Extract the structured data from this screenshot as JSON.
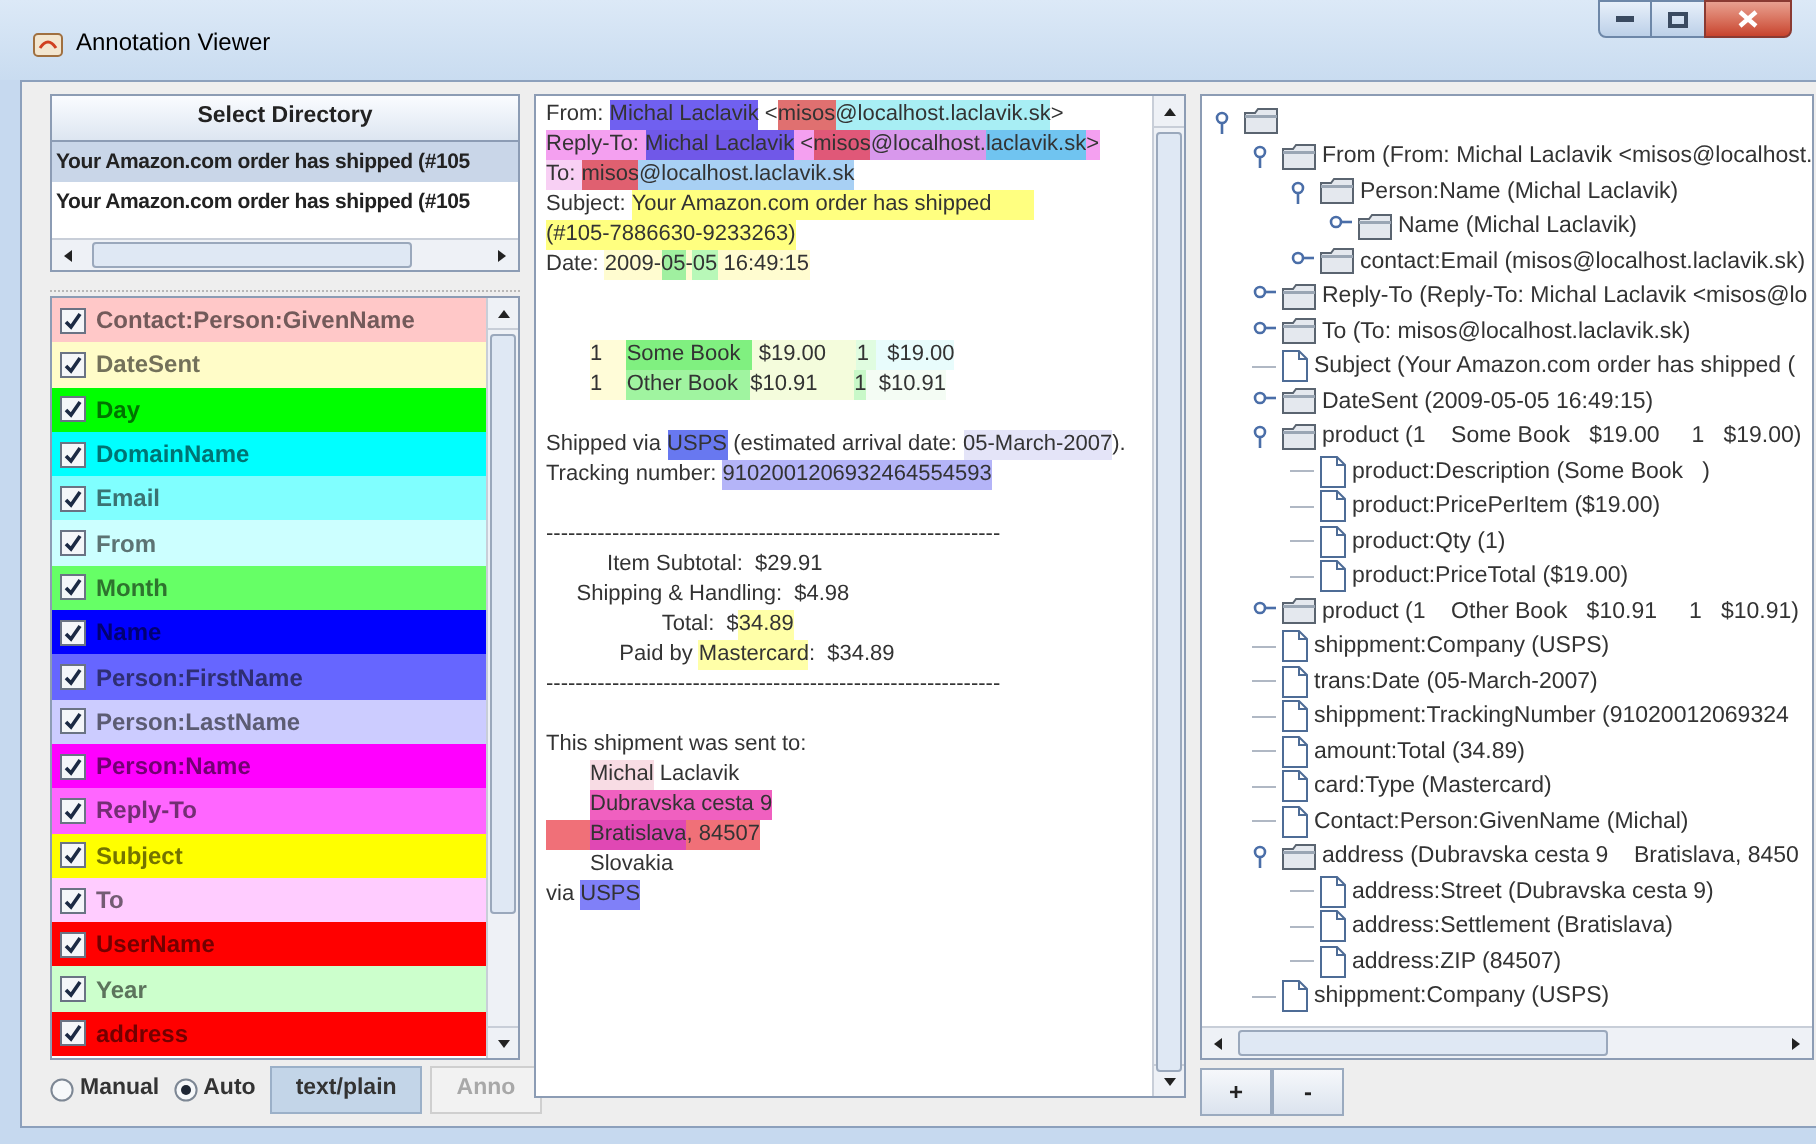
{
  "window": {
    "title": "Annotation Viewer"
  },
  "left": {
    "select_button": "Select Directory",
    "documents": [
      {
        "label": "Your Amazon.com order has shipped (#105",
        "selected": true
      },
      {
        "label": "Your Amazon.com order has shipped (#105",
        "selected": false
      }
    ],
    "annotation_types": [
      {
        "name": "Contact:Person:GivenName",
        "color": "#ffc8c8",
        "checked": true
      },
      {
        "name": "DateSent",
        "color": "#fffcc8",
        "checked": true
      },
      {
        "name": "Day",
        "color": "#00ff00",
        "checked": true
      },
      {
        "name": "DomainName",
        "color": "#00ffff",
        "checked": true
      },
      {
        "name": "Email",
        "color": "#80ffff",
        "checked": true
      },
      {
        "name": "From",
        "color": "#ccffff",
        "checked": true
      },
      {
        "name": "Month",
        "color": "#66ff66",
        "checked": true
      },
      {
        "name": "Name",
        "color": "#0000ff",
        "checked": true
      },
      {
        "name": "Person:FirstName",
        "color": "#6666ff",
        "checked": true
      },
      {
        "name": "Person:LastName",
        "color": "#ccccff",
        "checked": true
      },
      {
        "name": "Person:Name",
        "color": "#ff00ff",
        "checked": true
      },
      {
        "name": "Reply-To",
        "color": "#ff66ff",
        "checked": true
      },
      {
        "name": "Subject",
        "color": "#ffff00",
        "checked": true
      },
      {
        "name": "To",
        "color": "#ffccff",
        "checked": true
      },
      {
        "name": "UserName",
        "color": "#ff0000",
        "checked": true
      },
      {
        "name": "Year",
        "color": "#ccffcc",
        "checked": true
      },
      {
        "name": "address",
        "color": "#ff0000",
        "checked": true
      }
    ],
    "mode_options": [
      {
        "label": "Manual",
        "selected": false
      },
      {
        "label": "Auto",
        "selected": true
      }
    ],
    "buttons": [
      {
        "label": "text/plain",
        "pressed": true,
        "disabled": false
      },
      {
        "label": "Anno",
        "pressed": false,
        "disabled": true
      }
    ]
  },
  "document": {
    "lines": [
      {
        "kind": "text",
        "segments": [
          {
            "text": "From: "
          },
          {
            "text": "Michal Laclavik",
            "color": "#7060f0"
          },
          {
            "text": " <"
          },
          {
            "text": "misos",
            "color": "#e07070"
          },
          {
            "text": "@localhost.laclavik.sk",
            "color": "#a8eef4"
          },
          {
            "text": ">"
          }
        ]
      },
      {
        "kind": "text",
        "segments": [
          {
            "text": "Reply-To: ",
            "color": "#f4a0f0"
          },
          {
            "text": "Michal Laclavik",
            "color": "#7058e8"
          },
          {
            "text": " <",
            "color": "#f4a0f0"
          },
          {
            "text": "misos",
            "color": "#e05878"
          },
          {
            "text": "@localhost.",
            "color": "#d898ec"
          },
          {
            "text": "laclavik.sk",
            "color": "#70c4f0"
          },
          {
            "text": ">",
            "color": "#f4a0f0"
          }
        ]
      },
      {
        "kind": "text",
        "segments": [
          {
            "text": "To: ",
            "color": "#f8d0f4"
          },
          {
            "text": "misos",
            "color": "#e06070"
          },
          {
            "text": "@localhost.laclavik.sk",
            "color": "#a8d0f4"
          }
        ]
      },
      {
        "kind": "text",
        "segments": [
          {
            "text": "Subject: "
          },
          {
            "text": "Your Amazon.com order has shipped       ",
            "color": "#ffff80"
          }
        ]
      },
      {
        "kind": "text",
        "segments": [
          {
            "text": "(#105-7886630-9233263)",
            "color": "#ffff80"
          }
        ]
      },
      {
        "kind": "text",
        "segments": [
          {
            "text": "Date: "
          },
          {
            "text": "2009-",
            "color": "#fffcd0"
          },
          {
            "text": "05",
            "color": "#a0f0a0"
          },
          {
            "text": "-",
            "color": "#fffcd0"
          },
          {
            "text": "05",
            "color": "#b8f8b8"
          },
          {
            "text": " 16:49:15",
            "color": "#fffcd0"
          }
        ]
      },
      {
        "kind": "blank"
      },
      {
        "kind": "blank"
      },
      {
        "kind": "indented",
        "segments": [
          {
            "text": "1    ",
            "color": "#fffcd8"
          },
          {
            "text": "Some Book  ",
            "color": "#80f080"
          },
          {
            "text": " $19.00     ",
            "color": "#f4fcdc"
          },
          {
            "text": "1 ",
            "color": "#e0fce0"
          },
          {
            "text": "  $19.00",
            "color": "#e8fcfc"
          }
        ]
      },
      {
        "kind": "indented",
        "segments": [
          {
            "text": "1    ",
            "color": "#fffcd8"
          },
          {
            "text": "Other Book  ",
            "color": "#a0f4a0"
          },
          {
            "text": "$10.91      ",
            "color": "#f4fcdc"
          },
          {
            "text": "1",
            "color": "#c8f8c8"
          },
          {
            "text": "  $10.91",
            "color": "#f4fcf4"
          }
        ]
      },
      {
        "kind": "blank"
      },
      {
        "kind": "text",
        "segments": [
          {
            "text": "Shipped via "
          },
          {
            "text": "USPS",
            "color": "#6878f0"
          },
          {
            "text": " (estimated arrival date: "
          },
          {
            "text": "05-March-2007",
            "color": "#e4e4f8"
          },
          {
            "text": ")."
          }
        ]
      },
      {
        "kind": "text",
        "segments": [
          {
            "text": "Tracking number: "
          },
          {
            "text": "9102001206932464554593",
            "color": "#b4b4f8"
          }
        ]
      },
      {
        "kind": "blank"
      },
      {
        "kind": "text",
        "segments": [
          {
            "text": "--------------------------------------------------------------"
          }
        ]
      },
      {
        "kind": "text",
        "segments": [
          {
            "text": "          Item Subtotal:  $29.91"
          }
        ]
      },
      {
        "kind": "text",
        "segments": [
          {
            "text": "     Shipping & Handling:  $4.98"
          }
        ]
      },
      {
        "kind": "text",
        "segments": [
          {
            "text": "                   Total:  $"
          },
          {
            "text": "34.89",
            "color": "#ffffa8"
          }
        ]
      },
      {
        "kind": "text",
        "segments": [
          {
            "text": "            Paid by "
          },
          {
            "text": "Mastercard",
            "color": "#ffffa8"
          },
          {
            "text": ":  $34.89"
          }
        ]
      },
      {
        "kind": "text",
        "segments": [
          {
            "text": "--------------------------------------------------------------"
          }
        ]
      },
      {
        "kind": "blank"
      },
      {
        "kind": "text",
        "segments": [
          {
            "text": "This shipment was sent to:"
          }
        ]
      },
      {
        "kind": "indented",
        "segments": [
          {
            "text": "Michal",
            "color": "#f8dce4"
          },
          {
            "text": " Laclavik"
          }
        ]
      },
      {
        "kind": "indented",
        "segments": [
          {
            "text": "Dubravska cesta 9",
            "color": "#f060c0"
          }
        ]
      },
      {
        "kind": "text",
        "segments": [
          {
            "kind": "indent",
            "color": "#f07078"
          },
          {
            "kind": "text",
            "text": "Bratislava",
            "color": "#e048b4"
          },
          {
            "kind": "text",
            "text": ", 84507",
            "color": "#f07078"
          }
        ]
      },
      {
        "kind": "indented",
        "segments": [
          {
            "text": "Slovakia"
          }
        ]
      },
      {
        "kind": "text",
        "segments": [
          {
            "text": "via "
          },
          {
            "text": "USPS",
            "color": "#8080f8"
          }
        ]
      }
    ]
  },
  "tree": {
    "root": {
      "kind": "folder",
      "expanded": true,
      "children": [
        {
          "kind": "folder",
          "label": "From (From: Michal Laclavik <misos@localhost.",
          "expanded": true,
          "children": [
            {
              "kind": "folder",
              "label": "Person:Name (Michal Laclavik)",
              "expanded": true,
              "children": [
                {
                  "kind": "folder",
                  "label": "Name (Michal Laclavik)",
                  "expanded": false
                }
              ]
            },
            {
              "kind": "folder",
              "label": "contact:Email (misos@localhost.laclavik.sk)",
              "expanded": false
            }
          ]
        },
        {
          "kind": "folder",
          "label": "Reply-To (Reply-To: Michal Laclavik <misos@lo",
          "expanded": false
        },
        {
          "kind": "folder",
          "label": "To (To: misos@localhost.laclavik.sk)",
          "expanded": false
        },
        {
          "kind": "file",
          "label": "Subject (Your Amazon.com order has shipped ("
        },
        {
          "kind": "folder",
          "label": "DateSent (2009-05-05 16:49:15)",
          "expanded": false
        },
        {
          "kind": "folder",
          "label": "product (1    Some Book   $19.00     1   $19.00)",
          "expanded": true,
          "children": [
            {
              "kind": "file",
              "label": "product:Description (Some Book   )"
            },
            {
              "kind": "file",
              "label": "product:PricePerItem ($19.00)"
            },
            {
              "kind": "file",
              "label": "product:Qty (1)"
            },
            {
              "kind": "file",
              "label": "product:PriceTotal ($19.00)"
            }
          ]
        },
        {
          "kind": "folder",
          "label": "product (1    Other Book   $10.91     1   $10.91)",
          "expanded": false
        },
        {
          "kind": "file",
          "label": "shippment:Company (USPS)"
        },
        {
          "kind": "file",
          "label": "trans:Date (05-March-2007)"
        },
        {
          "kind": "file",
          "label": "shippment:TrackingNumber (91020012069324"
        },
        {
          "kind": "file",
          "label": "amount:Total (34.89)"
        },
        {
          "kind": "file",
          "label": "card:Type (Mastercard)"
        },
        {
          "kind": "file",
          "label": "Contact:Person:GivenName (Michal)"
        },
        {
          "kind": "folder",
          "label": "address (Dubravska cesta 9    Bratislava, 8450",
          "expanded": true,
          "children": [
            {
              "kind": "file",
              "label": "address:Street (Dubravska cesta 9)"
            },
            {
              "kind": "file",
              "label": "address:Settlement (Bratislava)"
            },
            {
              "kind": "file",
              "label": "address:ZIP (84507)"
            }
          ]
        },
        {
          "kind": "file",
          "label": "shippment:Company (USPS)"
        }
      ]
    },
    "buttons": [
      "+",
      "-"
    ]
  }
}
